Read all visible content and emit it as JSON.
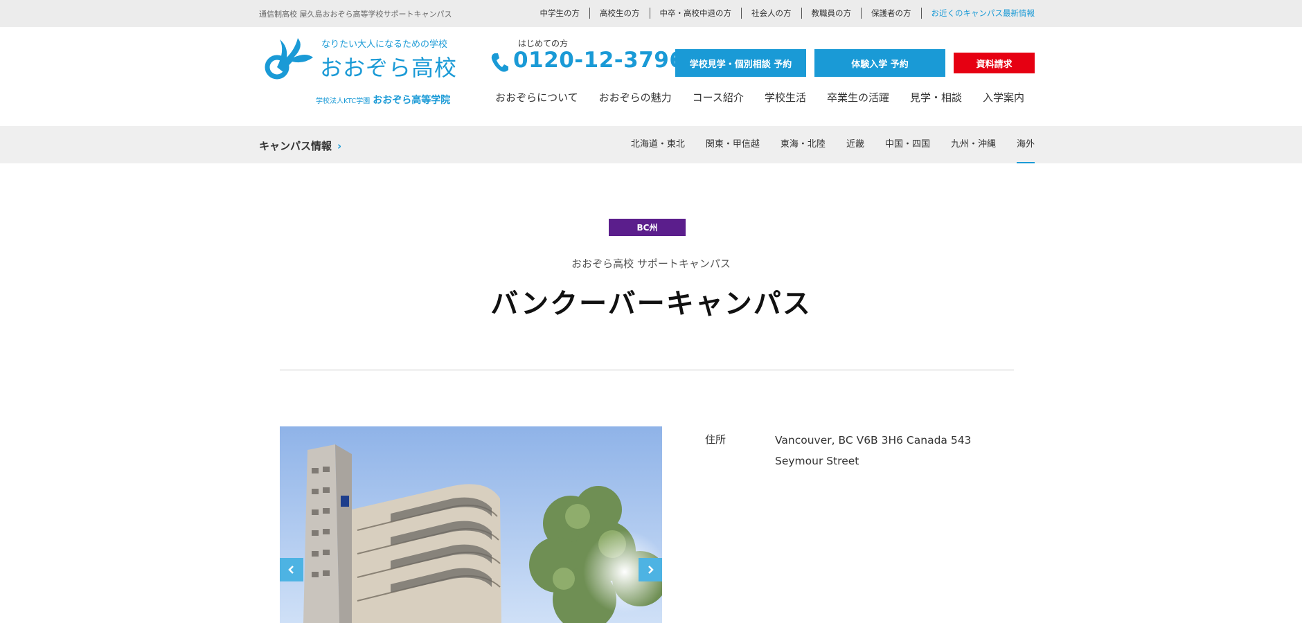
{
  "topbar": {
    "school_name": "通信制高校 屋久島おおぞら高等学校サポートキャンパス",
    "links": [
      {
        "label": "中学生の方"
      },
      {
        "label": "高校生の方"
      },
      {
        "label": "中卒・高校中退の方"
      },
      {
        "label": "社会人の方"
      },
      {
        "label": "教職員の方"
      },
      {
        "label": "保護者の方"
      },
      {
        "label": "お近くのキャンパス最新情報"
      }
    ]
  },
  "header": {
    "tagline": "なりたい大人になるための学校",
    "logo_title": "おおぞら高校",
    "sub_logo_small": "学校法人KTC学園",
    "sub_logo_big": "おおぞら高等学院",
    "phone_label": "はじめての方",
    "phone_number": "0120-12-3796",
    "buttons": {
      "visit": "学校見学・個別相談 予約",
      "trial": "体験入学 予約",
      "request": "資料請求"
    },
    "nav": [
      {
        "label": "おおぞらについて"
      },
      {
        "label": "おおぞらの魅力"
      },
      {
        "label": "コース紹介"
      },
      {
        "label": "学校生活"
      },
      {
        "label": "卒業生の活躍"
      },
      {
        "label": "見学・相談"
      },
      {
        "label": "入学案内"
      }
    ]
  },
  "subbar": {
    "campus_info": "キャンパス情報",
    "regions": [
      {
        "label": "北海道・東北"
      },
      {
        "label": "関東・甲信越"
      },
      {
        "label": "東海・北陸"
      },
      {
        "label": "近畿"
      },
      {
        "label": "中国・四国"
      },
      {
        "label": "九州・沖縄"
      },
      {
        "label": "海外"
      }
    ],
    "active_region": "海外"
  },
  "campus": {
    "badge": "BC州",
    "kicker": "おおぞら高校 サポートキャンパス",
    "title": "バンクーバーキャンパス",
    "address_label": "住所",
    "address_value": "Vancouver, BC V6B 3H6 Canada 543 Seymour Street"
  },
  "colors": {
    "accent_blue": "#1a9ad6",
    "request_red": "#e60012",
    "badge_purple": "#5b1e8c"
  }
}
